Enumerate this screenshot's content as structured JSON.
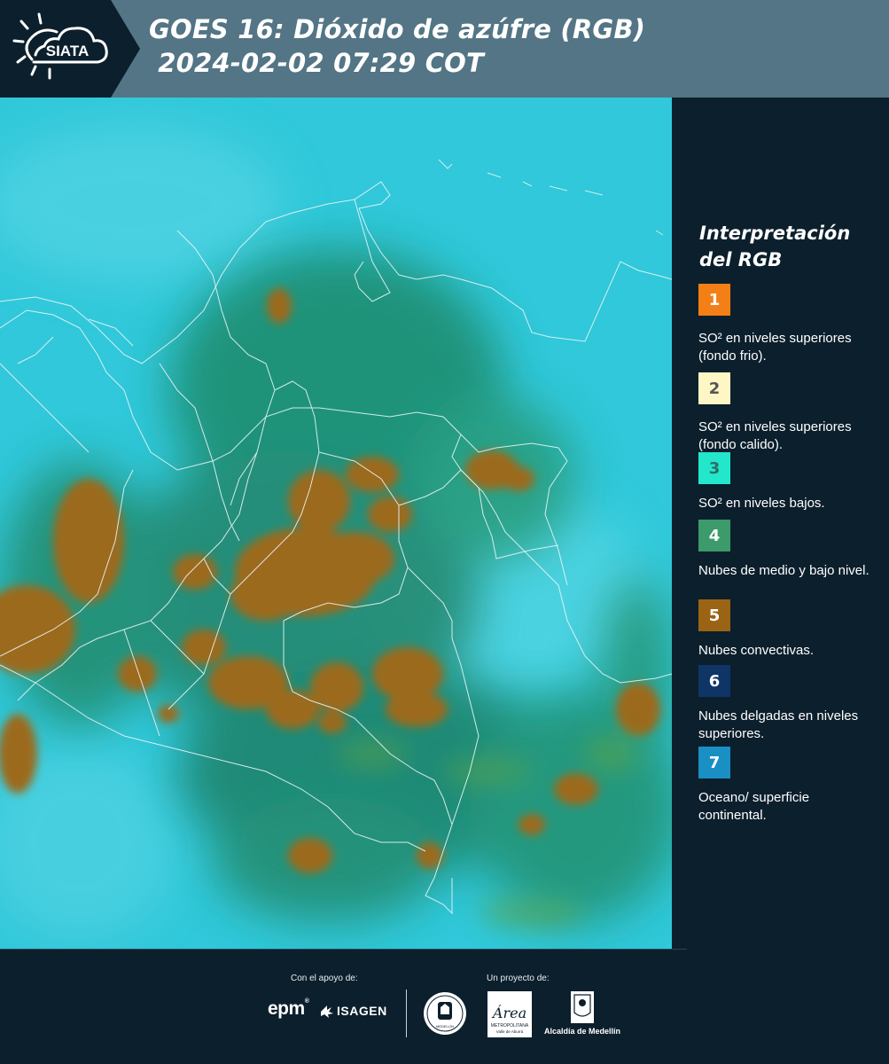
{
  "header": {
    "logo_text": "SIATA",
    "title_line1": "GOES 16: Dióxido de azúfre (RGB)",
    "title_line2": " 2024-02-02 07:29 COT"
  },
  "legend": {
    "title": "Interpretación del RGB",
    "items": [
      {
        "number": "1",
        "text": "SO² en niveles superiores (fondo frio).",
        "color": "#f57f17",
        "number_color": "#ffffff"
      },
      {
        "number": "2",
        "text": "SO² en niveles superiores (fondo calido).",
        "color": "#fff6c6",
        "number_color": "#555555"
      },
      {
        "number": "3",
        "text": "SO² en niveles bajos.",
        "color": "#23e7cb",
        "number_color": "#2c6e66"
      },
      {
        "number": "4",
        "text": "Nubes de medio y bajo nivel.",
        "color": "#3d9a6a",
        "number_color": "#ffffff"
      },
      {
        "number": "5",
        "text": "Nubes convectivas.",
        "color": "#9a6414",
        "number_color": "#ffffff"
      },
      {
        "number": "6",
        "text": "Nubes delgadas en niveles superiores.",
        "color": "#0f3566",
        "number_color": "#ffffff"
      },
      {
        "number": "7",
        "text": "Oceano/ superficie continental.",
        "color": "#1a8fc4",
        "number_color": "#ffffff"
      }
    ]
  },
  "footer": {
    "support_label": "Con el apoyo de:",
    "project_label": "Un proyecto de:",
    "sponsor1": "epm",
    "sponsor2": "ISAGEN",
    "area_logo_text": "Área",
    "area_logo_sub1": "METROPOLITANA",
    "area_logo_sub2": "Valle de Aburrá",
    "seal_text": "MEDELLÍN",
    "alcaldia": "Alcaldía de Medellín"
  },
  "colors": {
    "background": "#0c1f2c",
    "header_band": "#537585",
    "map_background": "#2ec6d8",
    "convective_clouds": "#9a6b1a",
    "low_clouds": "#2f8a6b"
  }
}
